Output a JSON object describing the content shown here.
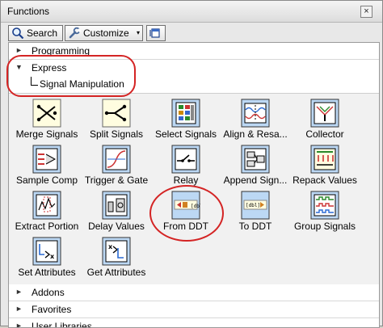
{
  "window": {
    "title": "Functions",
    "close_label": "×"
  },
  "toolbar": {
    "search_label": "Search",
    "customize_label": "Customize",
    "customize_dropdown": "▾"
  },
  "categories_top": [
    {
      "label": "Programming",
      "expanded": false,
      "arrow": "►"
    },
    {
      "label": "Express",
      "expanded": true,
      "arrow": "▼"
    }
  ],
  "subcategory": {
    "label": "Signal Manipulation"
  },
  "items": [
    {
      "label": "Merge Signals",
      "icon": "merge-signals-icon"
    },
    {
      "label": "Split Signals",
      "icon": "split-signals-icon"
    },
    {
      "label": "Select Signals",
      "icon": "select-signals-icon"
    },
    {
      "label": "Align & Resa...",
      "icon": "align-resample-icon"
    },
    {
      "label": "Collector",
      "icon": "collector-icon"
    },
    {
      "label": "Sample Comp",
      "icon": "sample-compression-icon"
    },
    {
      "label": "Trigger & Gate",
      "icon": "trigger-gate-icon"
    },
    {
      "label": "Relay",
      "icon": "relay-icon"
    },
    {
      "label": "Append Sign...",
      "icon": "append-signals-icon"
    },
    {
      "label": "Repack Values",
      "icon": "repack-values-icon"
    },
    {
      "label": "Extract Portion",
      "icon": "extract-portion-icon"
    },
    {
      "label": "Delay Values",
      "icon": "delay-values-icon"
    },
    {
      "label": "From DDT",
      "icon": "from-ddt-icon"
    },
    {
      "label": "To DDT",
      "icon": "to-ddt-icon"
    },
    {
      "label": "Group Signals",
      "icon": "group-signals-icon"
    },
    {
      "label": "Set Attributes",
      "icon": "set-attributes-icon"
    },
    {
      "label": "Get Attributes",
      "icon": "get-attributes-icon"
    }
  ],
  "categories_bottom": [
    {
      "label": "Addons",
      "arrow": "►"
    },
    {
      "label": "Favorites",
      "arrow": "►"
    },
    {
      "label": "User Libraries",
      "arrow": "►"
    }
  ],
  "colors": {
    "tile_blue": "#bcd8f4",
    "tile_yellow": "#fffde0",
    "highlight_red": "#d42424"
  }
}
